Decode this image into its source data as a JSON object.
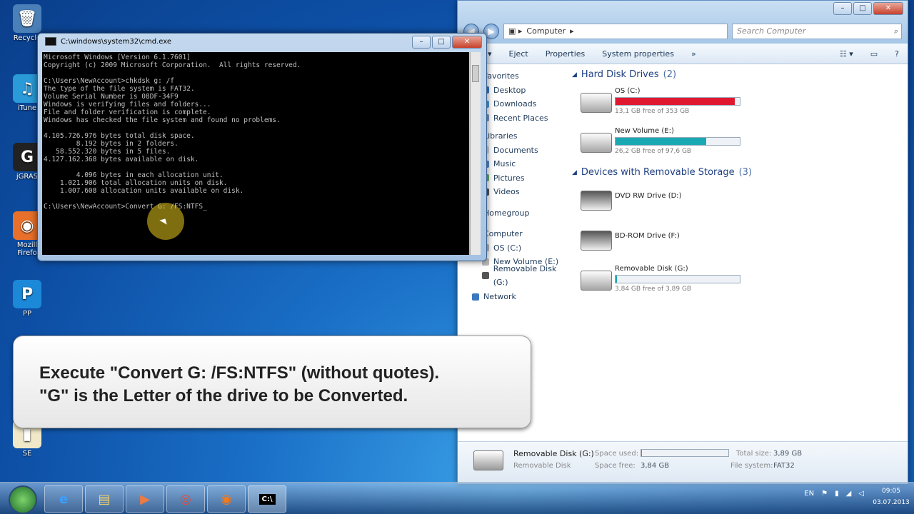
{
  "desktop": {
    "icons": [
      {
        "label": "Recycle",
        "glyph": "🗑"
      },
      {
        "label": "iTune",
        "glyph": "♫"
      },
      {
        "label": "jGRAS",
        "glyph": "G"
      },
      {
        "label": "Mozill\nFirefo",
        "glyph": "◉"
      },
      {
        "label": "PP",
        "glyph": "P"
      },
      {
        "label": "SE",
        "glyph": "▮"
      }
    ]
  },
  "cmd": {
    "title": "C:\\windows\\system32\\cmd.exe",
    "lines": [
      "Microsoft Windows [Version 6.1.7601]",
      "Copyright (c) 2009 Microsoft Corporation.  All rights reserved.",
      "",
      "C:\\Users\\NewAccount>chkdsk g: /f",
      "The type of the file system is FAT32.",
      "Volume Serial Number is 08DF-34F9",
      "Windows is verifying files and folders...",
      "File and folder verification is complete.",
      "Windows has checked the file system and found no problems.",
      "",
      "4.105.726.976 bytes total disk space.",
      "        8.192 bytes in 2 folders.",
      "   58.552.320 bytes in 5 files.",
      "4.127.162.368 bytes available on disk.",
      "",
      "        4.096 bytes in each allocation unit.",
      "    1.021.906 total allocation units on disk.",
      "    1.007.608 allocation units available on disk.",
      "",
      "C:\\Users\\NewAccount>Convert G: /FS:NTFS_"
    ]
  },
  "explorer": {
    "address": [
      "Computer"
    ],
    "search_placeholder": "Search Computer",
    "toolbar": [
      "ance ▾",
      "Eject",
      "Properties",
      "System properties",
      "»"
    ],
    "nav": {
      "favorites": "Favorites",
      "favorites_items": [
        "Desktop",
        "Downloads",
        "Recent Places"
      ],
      "libraries": "Libraries",
      "libraries_items": [
        "Documents",
        "Music",
        "Pictures",
        "Videos"
      ],
      "homegroup": "Homegroup",
      "computer": "Computer",
      "computer_items": [
        "OS (C:)",
        "New Volume (E:)",
        "Removable Disk (G:)"
      ],
      "network": "Network"
    },
    "hard_disk_section": {
      "title": "Hard Disk Drives",
      "count": "(2)"
    },
    "hard_disks": [
      {
        "name": "OS (C:)",
        "free": "13,1 GB free of 353 GB",
        "used_fraction": 0.96,
        "color": "#e0182f"
      },
      {
        "name": "New Volume (E:)",
        "free": "26,2 GB free of 97,6 GB",
        "used_fraction": 0.73,
        "color": "#1aa9b3"
      }
    ],
    "removable_section": {
      "title": "Devices with Removable Storage",
      "count": "(3)"
    },
    "removable": [
      {
        "name": "DVD RW Drive (D:)",
        "free": "",
        "type": "opt"
      },
      {
        "name": "BD-ROM Drive (F:)",
        "free": "",
        "type": "opt"
      },
      {
        "name": "Removable Disk (G:)",
        "free": "3,84 GB free of 3,89 GB",
        "used_fraction": 0.012,
        "color": "#1aa9b3",
        "type": "usb"
      }
    ],
    "details": {
      "name": "Removable Disk (G:)",
      "kind": "Removable Disk",
      "space_used_label": "Space used:",
      "space_free_label": "Space free:",
      "space_free": "3,84 GB",
      "total_size_label": "Total size:",
      "total_size": "3,89 GB",
      "fs_label": "File system:",
      "fs": "FAT32"
    }
  },
  "callout": {
    "line1": "Execute \"Convert G: /FS:NTFS\" (without quotes).",
    "line2": "\"G\" is the Letter of the drive to be Converted."
  },
  "taskbar": {
    "items": [
      "e",
      "▤",
      "▶",
      "◎",
      "◉",
      "C:\\"
    ],
    "lang": "EN",
    "time": "09:05",
    "date": "03.07.2013"
  }
}
